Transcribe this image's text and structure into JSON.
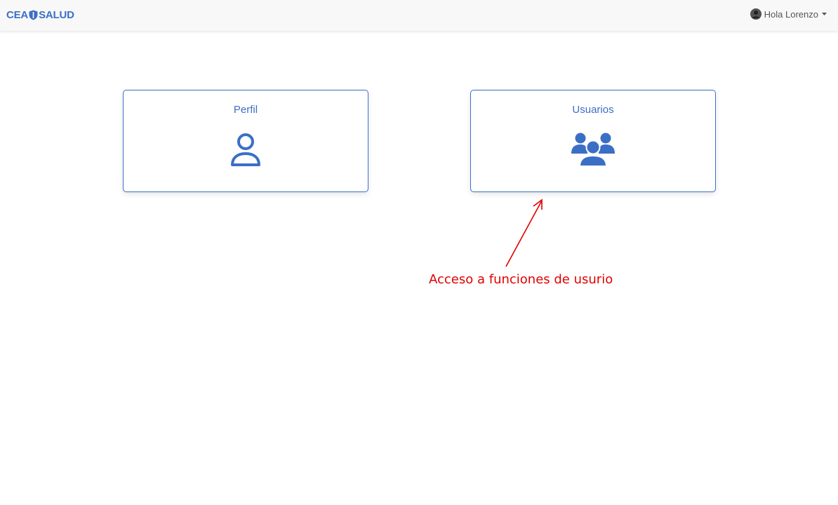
{
  "navbar": {
    "brand_left": "CEA",
    "brand_right": "SALUD",
    "brand_icon": "shield-icon",
    "user_greeting": "Hola Lorenzo",
    "avatar_icon": "avatar-icon",
    "caret_icon": "caret-down-icon"
  },
  "cards": [
    {
      "title": "Perfil",
      "icon": "user-icon"
    },
    {
      "title": "Usuarios",
      "icon": "users-group-icon"
    }
  ],
  "annotation": {
    "text": "Acceso a funciones de usurio",
    "color": "#e00000"
  },
  "theme": {
    "accent": "#3b6fc6",
    "navbar_bg": "#f8f8f8"
  }
}
